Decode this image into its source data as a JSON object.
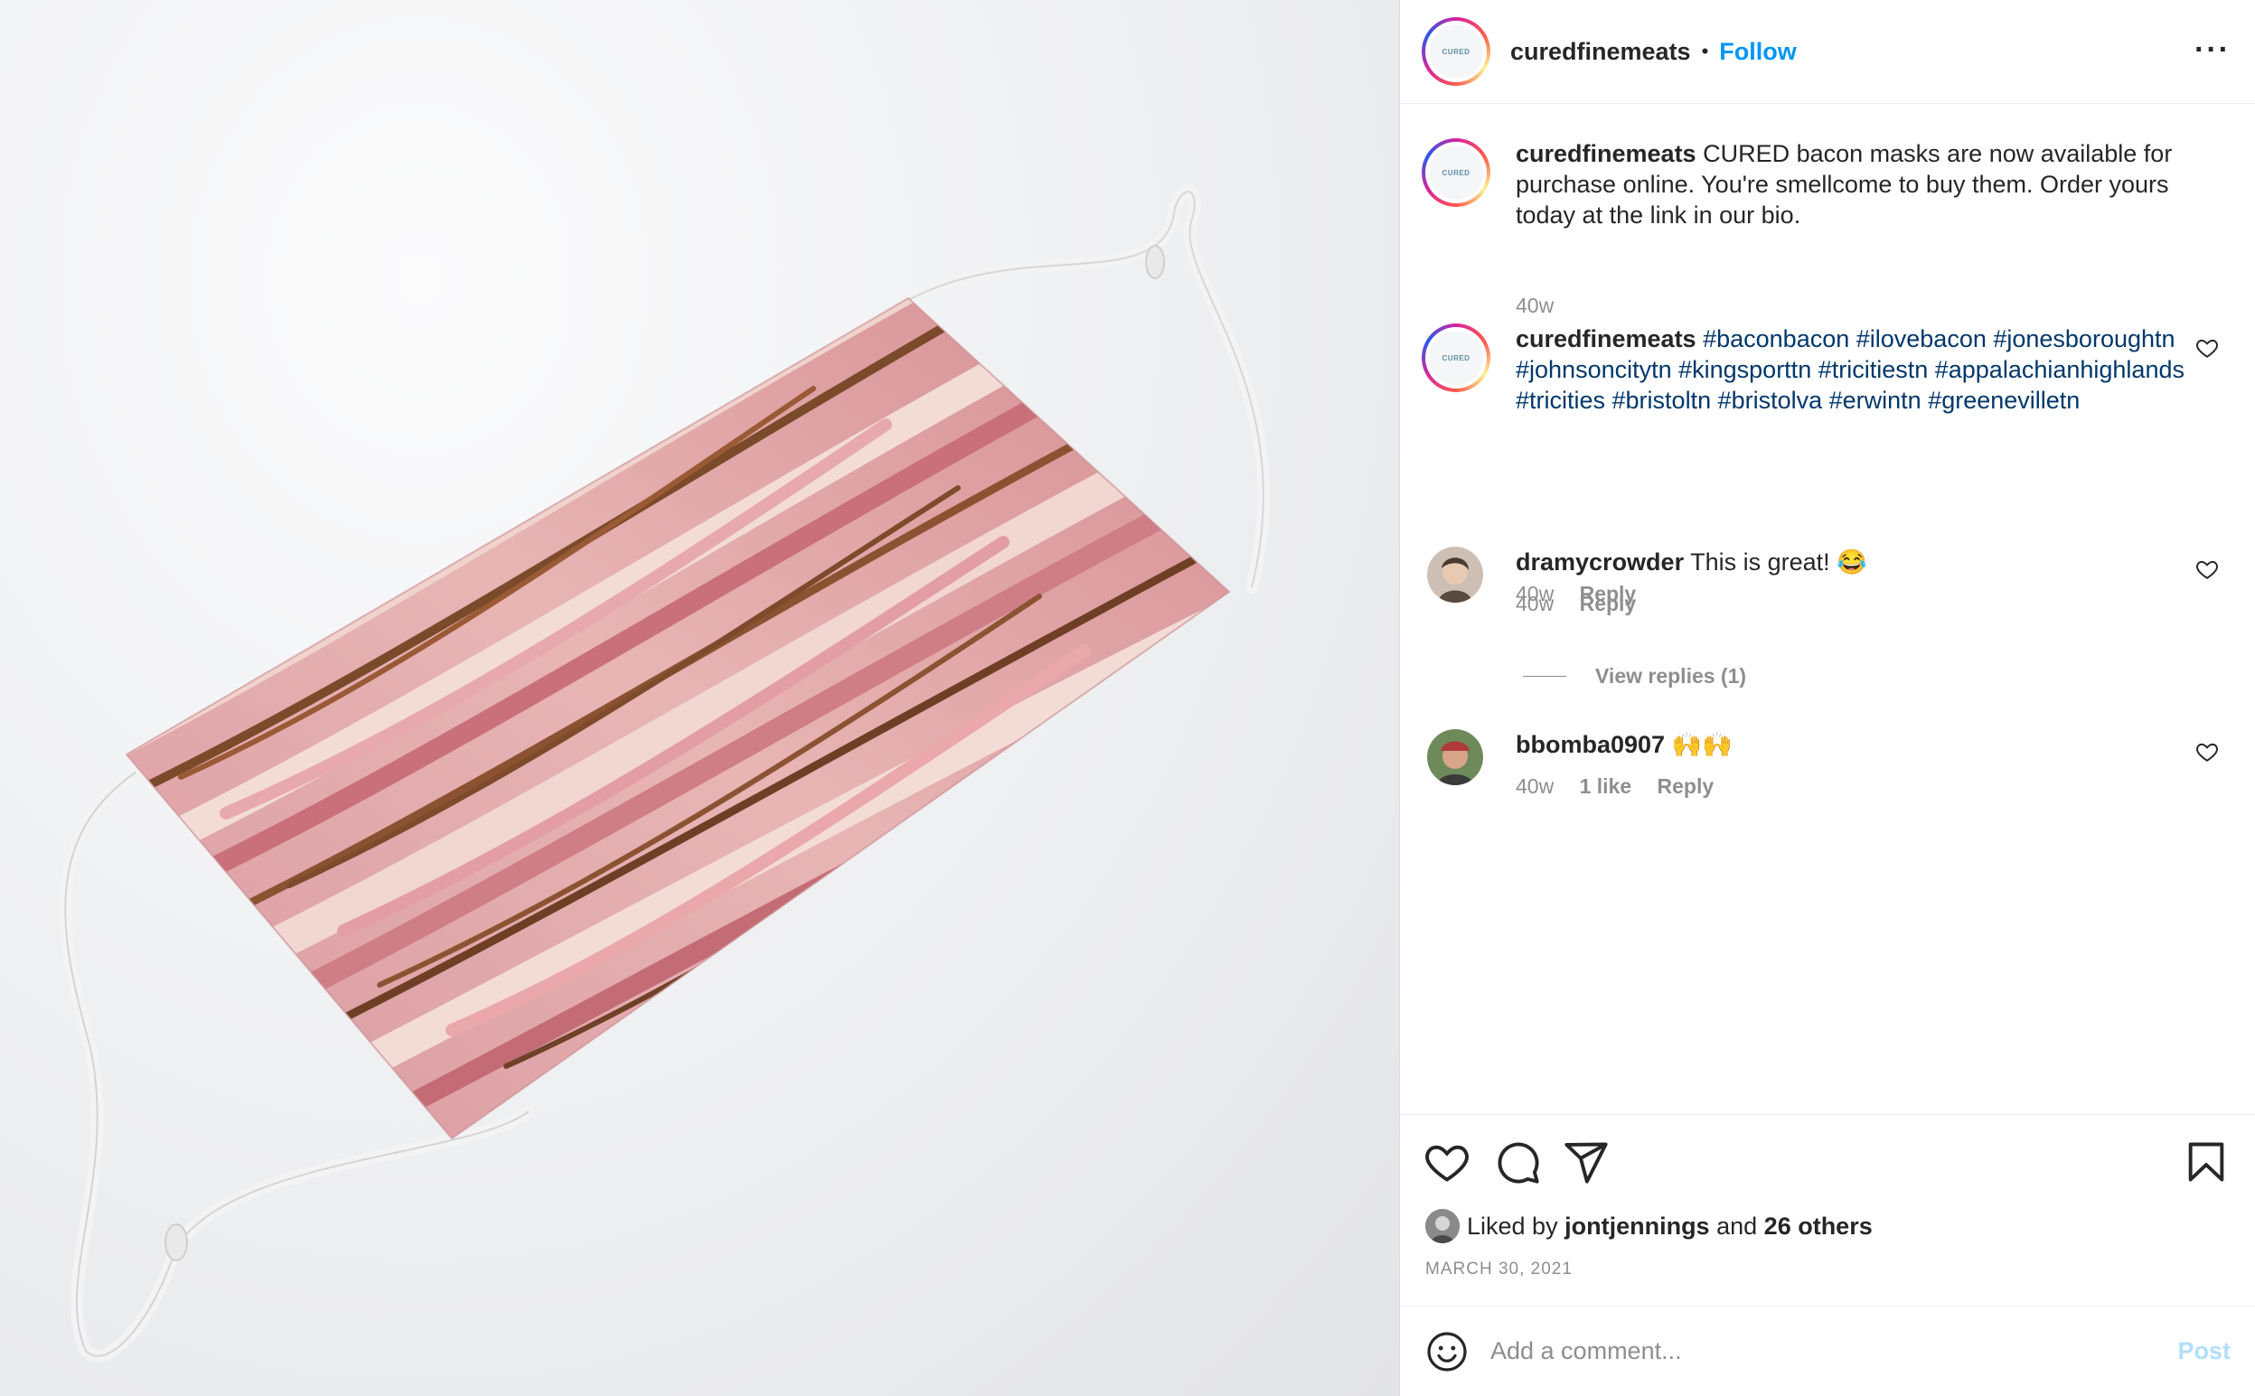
{
  "post": {
    "image_alt": "bacon-print face mask"
  },
  "header": {
    "username": "curedfinemeats",
    "separator": "•",
    "follow_label": "Follow",
    "more_label": "···",
    "avatar_logo_text": "CURED"
  },
  "comments": [
    {
      "username": "curedfinemeats",
      "text": "CURED bacon masks are now available for purchase online. You're smellcome to buy them. Order yours today at the link in our bio.",
      "time": "40w"
    },
    {
      "username": "curedfinemeats",
      "text": "#baconbacon #ilovebacon #jonesboroughtn #johnsoncitytn #kingsporttn #tricitiestn #appalachianhighlands #tricities #bristoltn #bristolva #erwintn #greenevilletn",
      "time": "40w",
      "reply_label": "Reply"
    },
    {
      "username": "dramycrowder",
      "text": "This is great! 😂",
      "time": "40w",
      "reply_label": "Reply",
      "view_replies": "View replies (1)"
    },
    {
      "username": "bbomba0907",
      "text": "🙌🙌",
      "time": "40w",
      "likes": "1 like",
      "reply_label": "Reply"
    }
  ],
  "likes": {
    "prefix": "Liked by",
    "user": "jontjennings",
    "and": "and",
    "others": "26 others"
  },
  "date": "MARCH 30, 2021",
  "add_comment": {
    "placeholder": "Add a comment...",
    "post_label": "Post"
  },
  "colors": {
    "accent": "#0095f6",
    "hashtag": "#00376b",
    "muted": "#8e8e8e",
    "post_disabled": "#b2dffc"
  },
  "icons": [
    "heart-icon",
    "comment-icon",
    "share-icon",
    "bookmark-icon",
    "emoji-icon",
    "more-icon"
  ]
}
